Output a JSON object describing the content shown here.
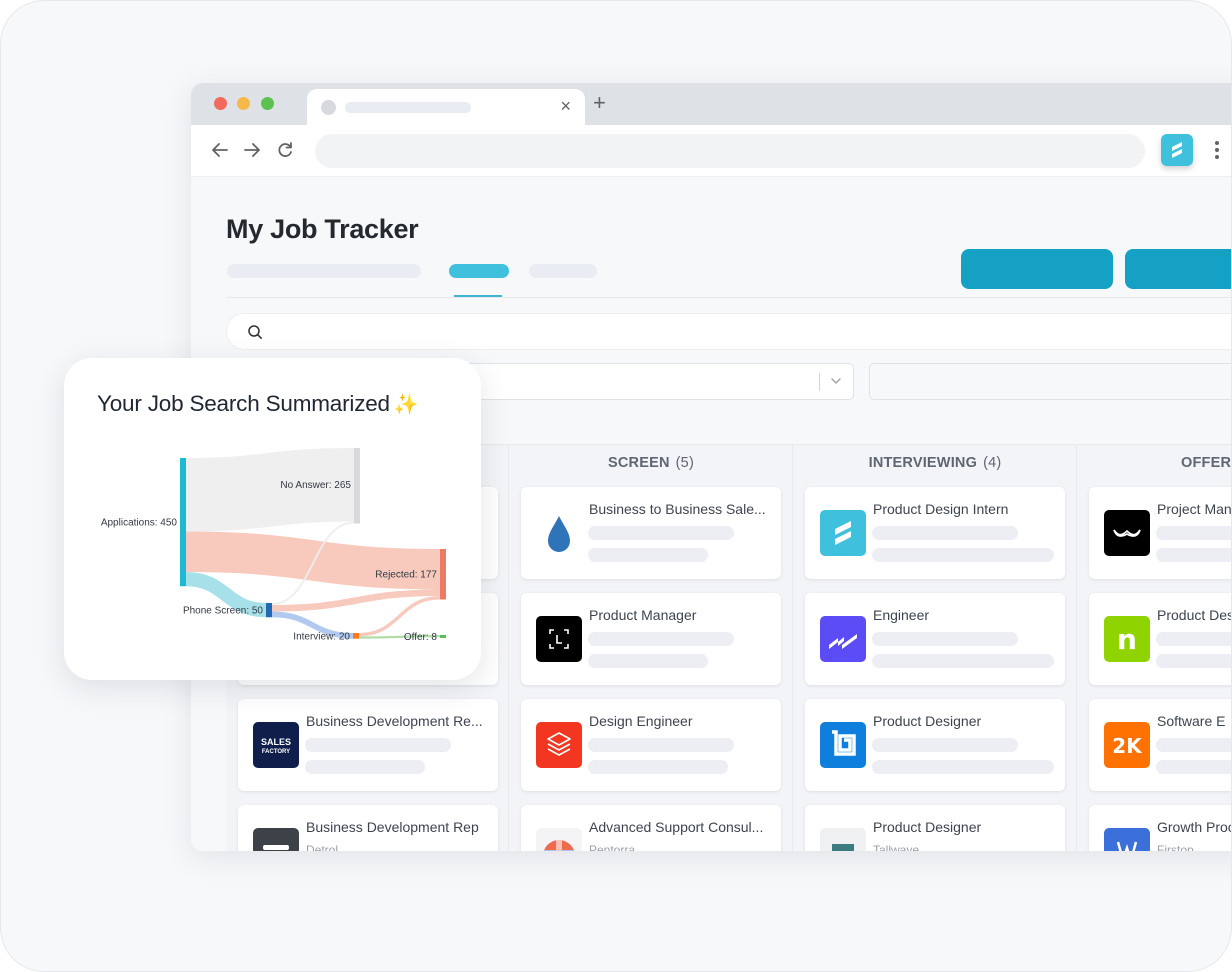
{
  "browser": {
    "tab": {
      "close_glyph": "×"
    },
    "new_tab_glyph": "+",
    "nav": {
      "back": "back-arrow-icon",
      "forward": "forward-arrow-icon",
      "reload": "reload-icon"
    },
    "extension_icon": "job-tracker-extension-icon",
    "menu_icon": "kebab-menu-icon"
  },
  "app": {
    "title": "My Job Tracker",
    "search_icon": "search-icon",
    "filter_chevron": "chevron-down-icon"
  },
  "board": {
    "columns": [
      {
        "name": "",
        "count": "",
        "cards": [
          {
            "title": "",
            "logo": "hidden"
          },
          {
            "title": "",
            "logo": "hidden"
          },
          {
            "title": "Business Development Re...",
            "logo": "sales-factory-logo",
            "logo_text": "SALES FACTORY",
            "color": "#0f1e4a"
          },
          {
            "title": "Business Development Rep",
            "company": "Detrol",
            "logo": "gray-logo",
            "color": "#3d4248"
          }
        ]
      },
      {
        "name": "SCREEN",
        "count": "(5)",
        "cards": [
          {
            "title": "Business to Business Sale...",
            "logo": "drop-logo",
            "color": "#2f74b8"
          },
          {
            "title": "Product Manager",
            "logo": "bracket-logo",
            "color": "#000000"
          },
          {
            "title": "Design Engineer",
            "logo": "stack-logo",
            "color": "#f2361f"
          },
          {
            "title": "Advanced Support Consul...",
            "company": "Pentorra",
            "logo": "pattern-logo",
            "color": "#f06a4f"
          }
        ]
      },
      {
        "name": "INTERVIEWING",
        "count": "(4)",
        "cards": [
          {
            "title": "Product Design Intern",
            "logo": "s-stripes-logo",
            "color": "#3fc0dd"
          },
          {
            "title": "Engineer",
            "logo": "slash-logo",
            "color": "#5b4cf5"
          },
          {
            "title": "Product Designer",
            "logo": "square-logo",
            "color": "#0f7fdd"
          },
          {
            "title": "Product Designer",
            "company": "Tallwave",
            "logo": "teal-logo",
            "color": "#3a7c80"
          }
        ]
      },
      {
        "name": "OFFER",
        "count": "",
        "cards": [
          {
            "title": "Project Man",
            "logo": "wings-logo",
            "color": "#000000"
          },
          {
            "title": "Product Des",
            "logo": "n-logo",
            "logo_text": "n",
            "color": "#8fd400"
          },
          {
            "title": "Software E",
            "logo": "2k-logo",
            "logo_text": "2K",
            "color": "#ff7100"
          },
          {
            "title": "Growth Proc",
            "company": "Firstop",
            "logo": "w-logo",
            "color": "#3b6fd9"
          }
        ]
      }
    ]
  },
  "summary": {
    "title": "Your Job Search Summarized",
    "sparkle": "✨"
  },
  "chart_data": {
    "type": "sankey",
    "title": "Your Job Search Summarized",
    "nodes": [
      {
        "id": "applications",
        "label": "Applications: 450",
        "value": 450,
        "color": "#1fb9d3"
      },
      {
        "id": "no_answer",
        "label": "No Answer: 265",
        "value": 265,
        "color": "#d8d9dd"
      },
      {
        "id": "rejected",
        "label": "Rejected: 177",
        "value": 177,
        "color": "#ef7a63"
      },
      {
        "id": "phone_screen",
        "label": "Phone Screen: 50",
        "value": 50,
        "color": "#1f69b5"
      },
      {
        "id": "interview",
        "label": "Interview: 20",
        "value": 20,
        "color": "#ff7a1a"
      },
      {
        "id": "offer",
        "label": "Offer: 8",
        "value": 8,
        "color": "#5cbb5c"
      }
    ],
    "links": [
      {
        "source": "applications",
        "target": "no_answer",
        "value": 258,
        "color": "#ededee"
      },
      {
        "source": "applications",
        "target": "rejected",
        "value": 142,
        "color": "#f7c3b6"
      },
      {
        "source": "applications",
        "target": "phone_screen",
        "value": 50,
        "color": "#9fdde8"
      },
      {
        "source": "phone_screen",
        "target": "no_answer",
        "value": 7,
        "color": "#ededee"
      },
      {
        "source": "phone_screen",
        "target": "rejected",
        "value": 23,
        "color": "#f7c3b6"
      },
      {
        "source": "phone_screen",
        "target": "interview",
        "value": 20,
        "color": "#a9c3ec"
      },
      {
        "source": "interview",
        "target": "rejected",
        "value": 12,
        "color": "#f7c3b6"
      },
      {
        "source": "interview",
        "target": "offer",
        "value": 8,
        "color": "#a8d9a0"
      }
    ]
  }
}
